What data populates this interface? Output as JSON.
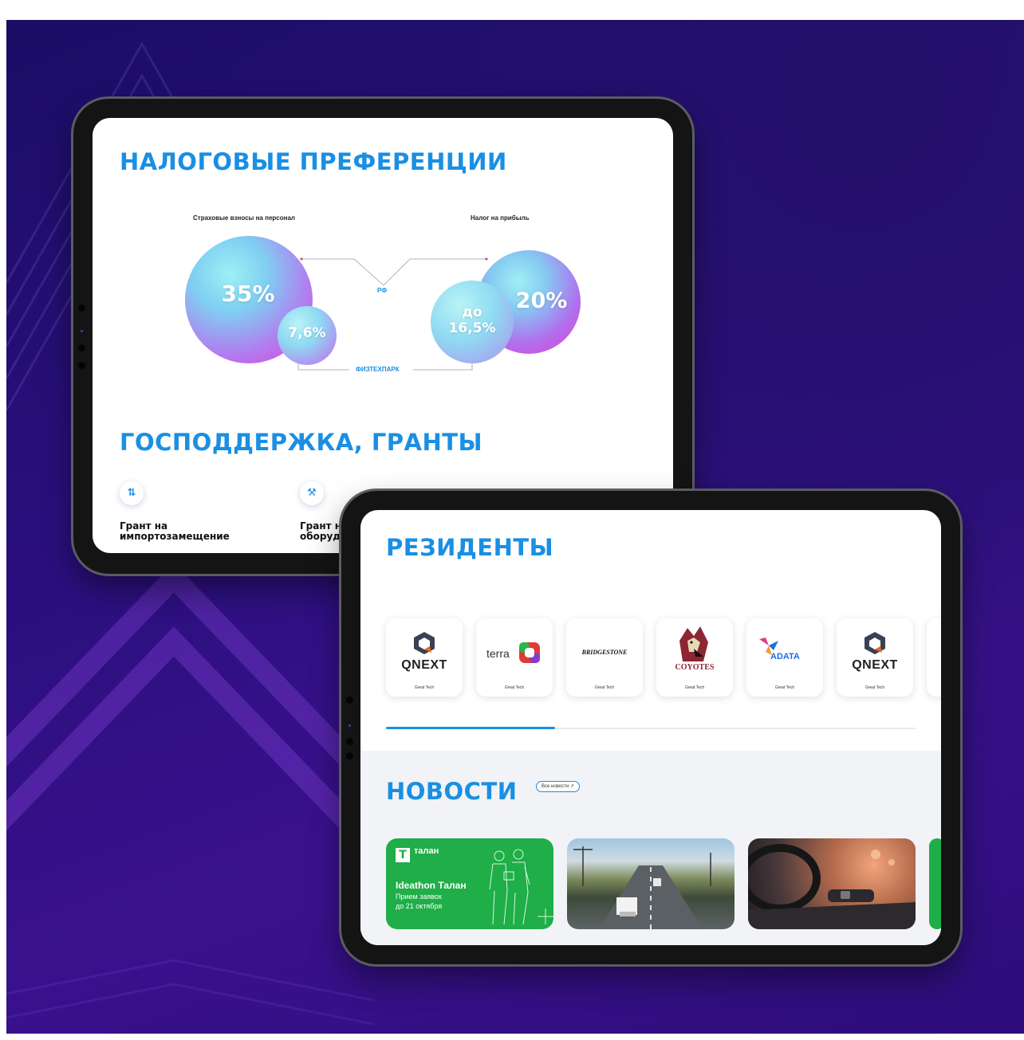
{
  "tablet_top": {
    "title": "НАЛОГОВЫЕ ПРЕФЕРЕНЦИИ",
    "label_left": "Страховые взносы на персонал",
    "label_right": "Налог на прибыль",
    "label_rf": "РФ",
    "label_park": "ФИЗТЕХПАРК",
    "sphere_35": "35%",
    "sphere_76": "7,6%",
    "sphere_do": "до",
    "sphere_165": "16,5%",
    "sphere_20": "20%",
    "section2_title": "ГОСПОДДЕРЖКА, ГРАНТЫ",
    "grants": [
      {
        "icon": "arrows-icon",
        "glyph": "⇅",
        "line1": "Грант на",
        "line2": "импортозамещение"
      },
      {
        "icon": "tools-icon",
        "glyph": "⚒",
        "line1": "Грант н",
        "line2": "оборуд"
      }
    ]
  },
  "tablet_bottom": {
    "residents_title": "РЕЗИДЕНТЫ",
    "residents": [
      {
        "name": "QNEXT",
        "caption": "Great Tech"
      },
      {
        "name": "terra",
        "caption": "Great Tech"
      },
      {
        "name": "BRIDGESTONE",
        "caption": "Great Tech"
      },
      {
        "name": "COYOTES",
        "caption": "Great Tech"
      },
      {
        "name": "ADATA",
        "caption": "Great Tech"
      },
      {
        "name": "QNEXT",
        "caption": "Great Tech"
      }
    ],
    "news_title": "НОВОСТИ",
    "news_all_button": "Все новости ↗",
    "news_card1": {
      "brand": "талан",
      "logo_letter": "T",
      "headline": "Ideathon Талан",
      "sub1": "Прием заявок",
      "sub2": "до 21 октября"
    }
  },
  "colors": {
    "accent_blue": "#1a8fe3",
    "news_green": "#1fae48",
    "background_purple": "#2a0f7d"
  }
}
